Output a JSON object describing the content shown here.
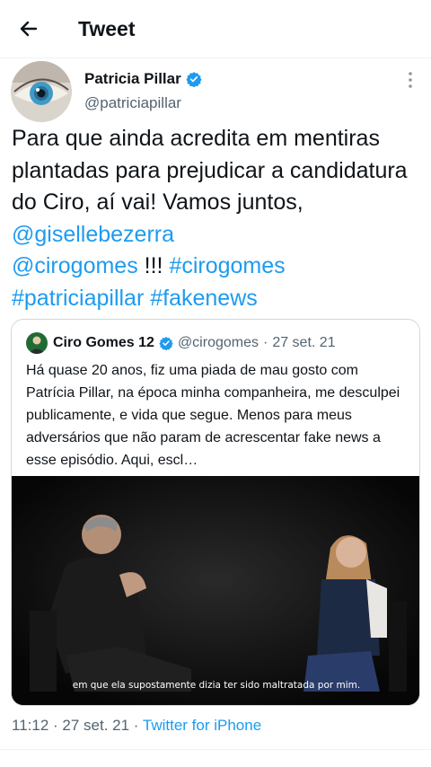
{
  "header": {
    "title": "Tweet",
    "back_icon": "arrow-left-icon"
  },
  "author": {
    "name": "Patricia Pillar",
    "handle": "@patriciapillar",
    "verified_icon": "verified-badge-icon"
  },
  "tweet": {
    "text_parts": {
      "plain1": "Para que ainda acredita em mentiras plantadas para prejudicar a candidatura do Ciro, aí vai! Vamos juntos, ",
      "mention1": "@gisellebezerra",
      "mention2": "@cirogomes",
      "plain2": " !!! ",
      "hashtag1": "#cirogomes",
      "hashtag2": "#patriciapillar",
      "hashtag3": "#fakenews"
    }
  },
  "quote": {
    "name": "Ciro Gomes 12",
    "handle": "@cirogomes",
    "separator": "·",
    "date": "27 set. 21",
    "text": "Há quase 20 anos, fiz uma piada de mau gosto com Patrícia Pillar, na época minha companheira, me desculpei publicamente, e vida que segue. Menos para meus adversários que não param de acrescentar fake news a esse episódio. Aqui, escl…",
    "video_subtitle": "em que ela supostamente dizia ter sido maltratada por mim."
  },
  "meta": {
    "time": "11:12",
    "separator1": " · ",
    "date": "27 set. 21",
    "separator2": " · ",
    "source": "Twitter for iPhone"
  },
  "colors": {
    "link": "#1d9bf0",
    "secondary": "#536471",
    "text": "#0f1419"
  }
}
